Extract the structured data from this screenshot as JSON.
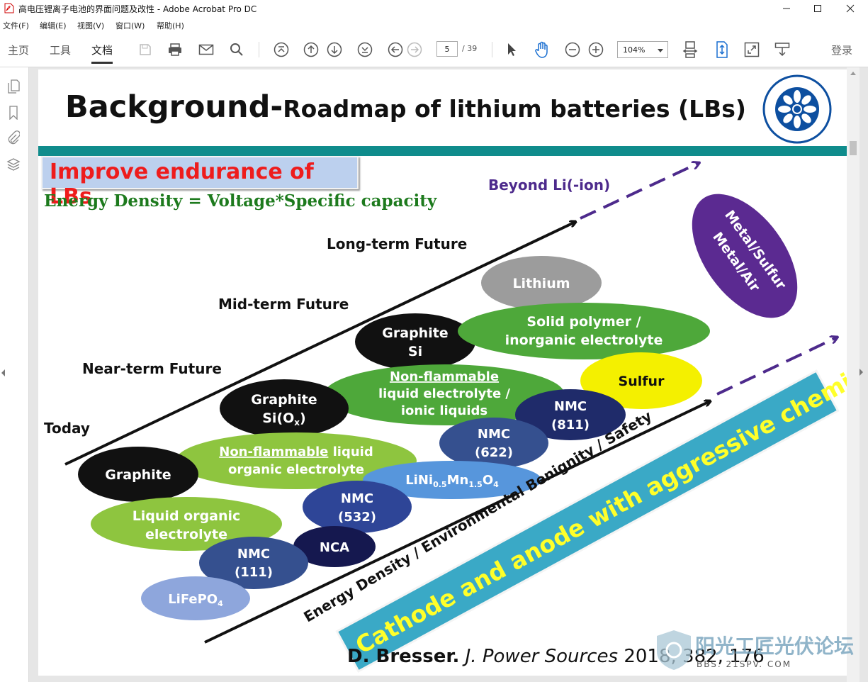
{
  "window": {
    "title": "高电压锂离子电池的界面问题及改性 - Adobe Acrobat Pro DC"
  },
  "menu": [
    "文件(F)",
    "编辑(E)",
    "视图(V)",
    "窗口(W)",
    "帮助(H)"
  ],
  "tabs": [
    "主页",
    "工具",
    "文档"
  ],
  "active_tab": "文档",
  "toolbar": {
    "page_current": "5",
    "page_total": "/ 39",
    "zoom": "104%",
    "login": "登录"
  },
  "slide": {
    "title_large": "Background-",
    "title_small": "Roadmap of lithium batteries (LBs)",
    "callout": "Improve endurance of LBs",
    "formula": "Energy Density = Voltage*Specific capacity",
    "stages": {
      "beyond": "Beyond Li(-ion)",
      "long": "Long-term Future",
      "mid": "Mid-term Future",
      "near": "Near-term Future",
      "today": "Today"
    },
    "ellipses": {
      "lithium": "Lithium",
      "solid1": "Solid polymer /",
      "solid2": "inorganic electrolyte",
      "graphite_si1": "Graphite",
      "graphite_si2": "Si",
      "sulfur": "Sulfur",
      "metal1": "Metal/Sulfur",
      "metal2": "Metal/Air",
      "nf_ionic1": "Non-flammable",
      "nf_ionic2": "liquid electrolyte /",
      "nf_ionic3": "ionic liquids",
      "nmc811_1": "NMC",
      "nmc811_2": "(811)",
      "gsiox1": "Graphite",
      "gsiox2": "Si(O",
      "gsiox_sub": "x",
      "gsiox_end": ")",
      "nmc622_1": "NMC",
      "nmc622_2": "(622)",
      "nf_org_u": "Non-flammable",
      "nf_org_rest": " liquid",
      "nf_org2": "organic electrolyte",
      "graphite": "Graphite",
      "lnmo_a": "LiNi",
      "lnmo_s1": "0.5",
      "lnmo_b": "Mn",
      "lnmo_s2": "1.5",
      "lnmo_c": "O",
      "lnmo_s3": "4",
      "nmc532_1": "NMC",
      "nmc532_2": "(532)",
      "liq1": "Liquid organic",
      "liq2": "electrolyte",
      "nca": "NCA",
      "nmc111_1": "NMC",
      "nmc111_2": "(111)",
      "lfp_a": "LiFePO",
      "lfp_s": "4"
    },
    "axis_label": "Energy Density / Environmental Benignity / Safety",
    "banner": "Cathode and anode with aggressive chemistry",
    "citation": {
      "author": "D. Bresser.",
      "journal": "J. Power Sources",
      "rest": "2018, 382, 176"
    },
    "watermark": {
      "line1": "阳光工匠光伏论坛",
      "line2": "BBS. 21SPV. COM"
    }
  }
}
